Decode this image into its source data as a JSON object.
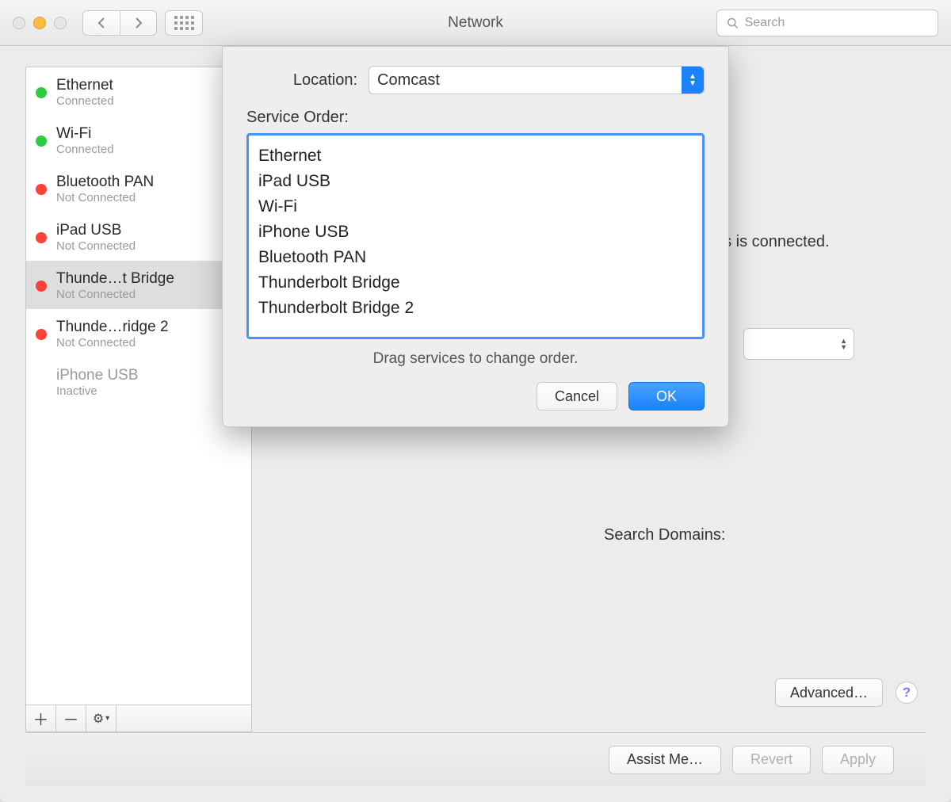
{
  "window": {
    "title": "Network"
  },
  "search": {
    "placeholder": "Search"
  },
  "sidebar": {
    "items": [
      {
        "name": "Ethernet",
        "status": "Connected",
        "dot": "green",
        "icon": "ethernet"
      },
      {
        "name": "Wi-Fi",
        "status": "Connected",
        "dot": "green",
        "icon": "wifi"
      },
      {
        "name": "Bluetooth PAN",
        "status": "Not Connected",
        "dot": "red",
        "icon": "bluetooth"
      },
      {
        "name": "iPad USB",
        "status": "Not Connected",
        "dot": "red",
        "icon": "phone"
      },
      {
        "name": "Thunde…t Bridge",
        "status": "Not Connected",
        "dot": "red",
        "icon": "thunderbolt",
        "selected": true
      },
      {
        "name": "Thunde…ridge 2",
        "status": "Not Connected",
        "dot": "red",
        "icon": "thunderbolt"
      },
      {
        "name": "iPhone USB",
        "status": "Inactive",
        "dot": "none",
        "icon": "phone",
        "inactive": true
      }
    ]
  },
  "detail": {
    "status_fragment": "es is connected.",
    "search_domains_label": "Search Domains:",
    "advanced_label": "Advanced…"
  },
  "bottom": {
    "assist": "Assist Me…",
    "revert": "Revert",
    "apply": "Apply"
  },
  "sheet": {
    "location_label": "Location:",
    "location_value": "Comcast",
    "order_label": "Service Order:",
    "order_items": [
      "Ethernet",
      "iPad USB",
      "Wi-Fi",
      "iPhone USB",
      "Bluetooth PAN",
      "Thunderbolt Bridge",
      "Thunderbolt Bridge 2"
    ],
    "hint": "Drag services to change order.",
    "cancel": "Cancel",
    "ok": "OK"
  },
  "icons": {
    "ethernet": "‹›",
    "wifi": "⋮",
    "bluetooth": "ᚼ",
    "phone": "▯",
    "thunderbolt": "‹›"
  }
}
